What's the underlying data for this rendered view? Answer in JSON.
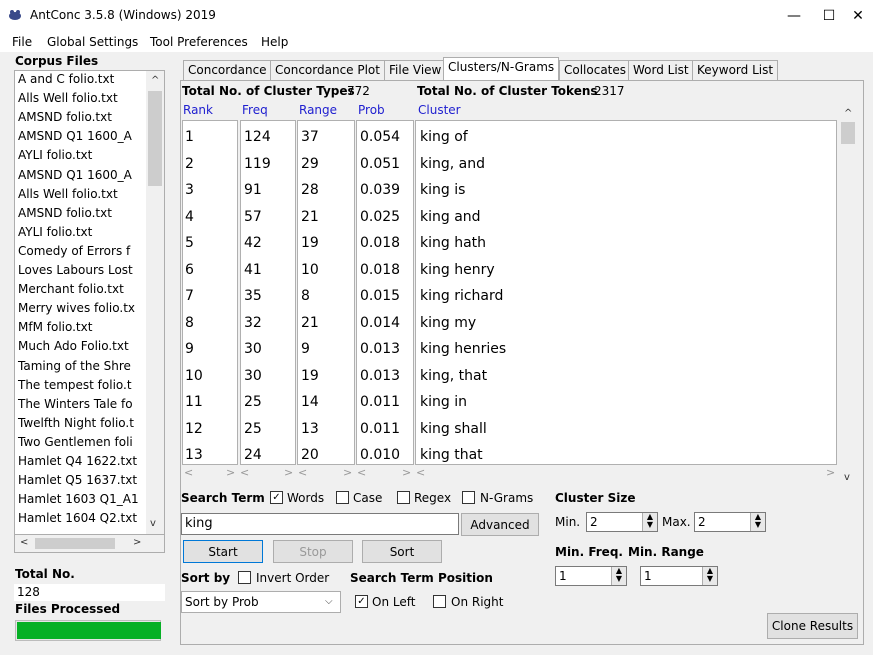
{
  "window": {
    "title": "AntConc 3.5.8 (Windows) 2019",
    "minimize": "—",
    "maximize": "☐",
    "close": "✕"
  },
  "menu": [
    "File",
    "Global Settings",
    "Tool Preferences",
    "Help"
  ],
  "left": {
    "corpus_label": "Corpus Files",
    "files": [
      "A and C folio.txt",
      "Alls Well folio.txt",
      "AMSND folio.txt",
      "AMSND Q1 1600_A",
      "AYLI folio.txt",
      "AMSND Q1 1600_A",
      "Alls Well folio.txt",
      "AMSND folio.txt",
      "AYLI folio.txt",
      "Comedy of Errors f",
      "Loves Labours Lost",
      "Merchant folio.txt",
      "Merry wives folio.tx",
      "MfM folio.txt",
      "Much Ado Folio.txt",
      "Taming of the Shre",
      "The tempest folio.t",
      "The Winters Tale fo",
      "Twelfth Night folio.t",
      "Two Gentlemen foli",
      "Hamlet Q4 1622.txt",
      "Hamlet Q5 1637.txt",
      "Hamlet 1603 Q1_A1",
      "Hamlet 1604 Q2.txt"
    ],
    "total_label": "Total No.",
    "total_value": "128",
    "processed_label": "Files Processed",
    "progress": 1.0
  },
  "tabs": [
    "Concordance",
    "Concordance Plot",
    "File View",
    "Clusters/N-Grams",
    "Collocates",
    "Word List",
    "Keyword List"
  ],
  "active_tab": 3,
  "stats": {
    "types_label": "Total No. of Cluster Types",
    "types_value": "772",
    "tokens_label": "Total No. of Cluster Tokens",
    "tokens_value": "2317"
  },
  "columns": [
    "Rank",
    "Freq",
    "Range",
    "Prob",
    "Cluster"
  ],
  "rows": [
    [
      "1",
      "124",
      "37",
      "0.054",
      "king of"
    ],
    [
      "2",
      "119",
      "29",
      "0.051",
      "king, and"
    ],
    [
      "3",
      "91",
      "28",
      "0.039",
      "king is"
    ],
    [
      "4",
      "57",
      "21",
      "0.025",
      "king and"
    ],
    [
      "5",
      "42",
      "19",
      "0.018",
      "king hath"
    ],
    [
      "6",
      "41",
      "10",
      "0.018",
      "king henry"
    ],
    [
      "7",
      "35",
      "8",
      "0.015",
      "king richard"
    ],
    [
      "8",
      "32",
      "21",
      "0.014",
      "king my"
    ],
    [
      "9",
      "30",
      "9",
      "0.013",
      "king henries"
    ],
    [
      "10",
      "30",
      "19",
      "0.013",
      "king, that"
    ],
    [
      "11",
      "25",
      "14",
      "0.011",
      "king in"
    ],
    [
      "12",
      "25",
      "13",
      "0.011",
      "king shall"
    ],
    [
      "13",
      "24",
      "20",
      "0.010",
      "king that"
    ]
  ],
  "search": {
    "label": "Search Term",
    "words": "Words",
    "words_checked": true,
    "case": "Case",
    "regex": "Regex",
    "ngrams": "N-Grams",
    "value": "king",
    "advanced": "Advanced",
    "start": "Start",
    "stop": "Stop",
    "sort": "Sort"
  },
  "sortby": {
    "label": "Sort by",
    "invert": "Invert Order",
    "value": "Sort by Prob"
  },
  "position": {
    "label": "Search Term Position",
    "left": "On Left",
    "left_checked": true,
    "right": "On Right"
  },
  "cluster_size": {
    "label": "Cluster Size",
    "min_label": "Min.",
    "min": "2",
    "max_label": "Max.",
    "max": "2"
  },
  "min_freq_label": "Min. Freq.",
  "min_range_label": "Min. Range",
  "min_freq": "1",
  "min_range": "1",
  "clone": "Clone Results"
}
